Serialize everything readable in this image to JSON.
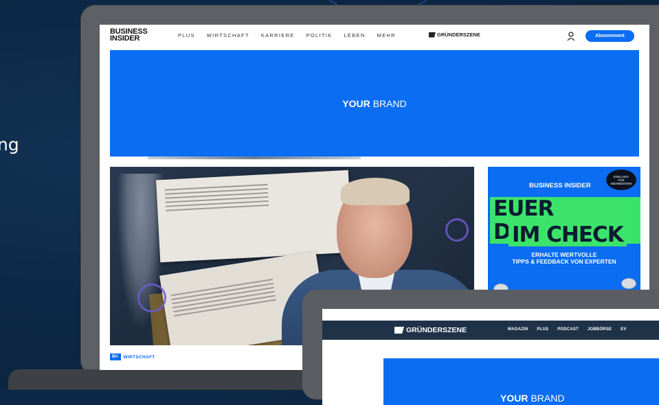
{
  "background": {
    "text": "ng"
  },
  "laptop": {
    "header": {
      "logo_line1": "BUSINESS",
      "logo_line2": "INSIDER",
      "nav": [
        "PLUS",
        "WIRTSCHAFT",
        "KARRIERE",
        "POLITIK",
        "LEBEN",
        "MEHR"
      ],
      "partner_logo": "GRÜNDERSZENE",
      "subscribe_label": "Abonnement"
    },
    "ad_banner": {
      "bold": "YOUR",
      "rest": "BRAND"
    },
    "article": {
      "badge": "BI+",
      "category": "WIRTSCHAFT"
    },
    "side_ad": {
      "brand": "BUSINESS INSIDER",
      "badge_line1": "EXKLUSIV",
      "badge_line2": "FÜR",
      "badge_line3": "ABONNENTEN",
      "headline1": "EUER DEPOT",
      "headline2": "IM CHECK",
      "sub1": "ERHALTE WERTVOLLE",
      "sub2": "TIPPS & FEEDBACK VON EXPERTEN"
    }
  },
  "tablet": {
    "logo": "GRÜNDERSZENE",
    "nav": [
      "MAGAZIN",
      "PLUS",
      "PODCAST",
      "JOBBÖRSE",
      "EV"
    ],
    "banner": {
      "bold": "YOUR",
      "rest": "BRAND"
    }
  },
  "colors": {
    "accent": "#0a6df2",
    "green": "#3be36a",
    "navy": "#1f3248"
  }
}
